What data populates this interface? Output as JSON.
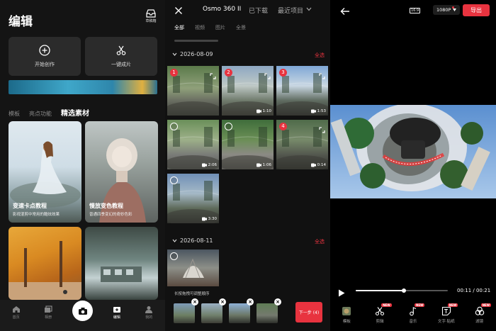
{
  "edit_screen": {
    "title": "编辑",
    "inbox_label": "草稿箱",
    "buttons": [
      {
        "label": "开始创作",
        "icon": "plus-circle-icon"
      },
      {
        "label": "一键成片",
        "icon": "scissors-icon"
      }
    ],
    "tabs": [
      "模板",
      "亮点功能",
      "精选素材"
    ],
    "active_tab": "精选素材",
    "cards": [
      {
        "title": "变速卡点教程",
        "subtitle": "影视混剪中常用的酷炫效果"
      },
      {
        "title": "慢放变色教程",
        "subtitle": "普通四季变幻的奇妙色彩"
      }
    ],
    "nav": [
      {
        "label": "首页",
        "icon": "home-icon"
      },
      {
        "label": "相册",
        "icon": "album-icon"
      },
      {
        "label": "",
        "icon": "camera-icon"
      },
      {
        "label": "编辑",
        "icon": "edit-icon"
      },
      {
        "label": "我的",
        "icon": "profile-icon"
      }
    ],
    "active_nav": "编辑"
  },
  "media_picker": {
    "title": "Osmo 360 II",
    "menu": [
      "已下载",
      "最近项目"
    ],
    "filter_tabs": [
      "全部",
      "视频",
      "图片",
      "全景"
    ],
    "active_filter": "全部",
    "groups": [
      {
        "date": "2026-08-09",
        "select_all": "全选",
        "items": [
          {
            "badge": "1",
            "duration": ""
          },
          {
            "badge": "2",
            "duration": "1:10"
          },
          {
            "badge": "3",
            "duration": "1:53"
          },
          {
            "badge": "",
            "duration": "2:06"
          },
          {
            "badge": "",
            "duration": "1:06"
          },
          {
            "badge": "4",
            "duration": "0:14"
          },
          {
            "badge": "",
            "duration": "3:30"
          }
        ]
      },
      {
        "date": "2026-08-11",
        "select_all": "全选",
        "items": [
          {
            "badge": "",
            "duration": ""
          }
        ]
      }
    ],
    "hint": "长按拖拽可调整顺序",
    "selected_count": 4,
    "next_button": "下一步 (4)"
  },
  "preview": {
    "aspect_label": "16:9",
    "resolution": "1080P",
    "export_label": "导出",
    "current_time": "00:11",
    "total_time": "00:21",
    "time_display": "00:11 / 00:21",
    "progress": 0.52,
    "tools": [
      {
        "label": "模板",
        "icon": "template-icon",
        "new": ""
      },
      {
        "label": "剪辑",
        "icon": "scissors-icon",
        "new": "NEW"
      },
      {
        "label": "音乐",
        "icon": "music-icon",
        "new": "NEW"
      },
      {
        "label": "文字·贴纸",
        "icon": "text-sticker-icon",
        "new": "NEW"
      },
      {
        "label": "滤镜",
        "icon": "filter-icon",
        "new": "NEW"
      }
    ]
  },
  "colors": {
    "accent": "#e8333f",
    "background": "#000000",
    "card": "#2b2b2b"
  }
}
